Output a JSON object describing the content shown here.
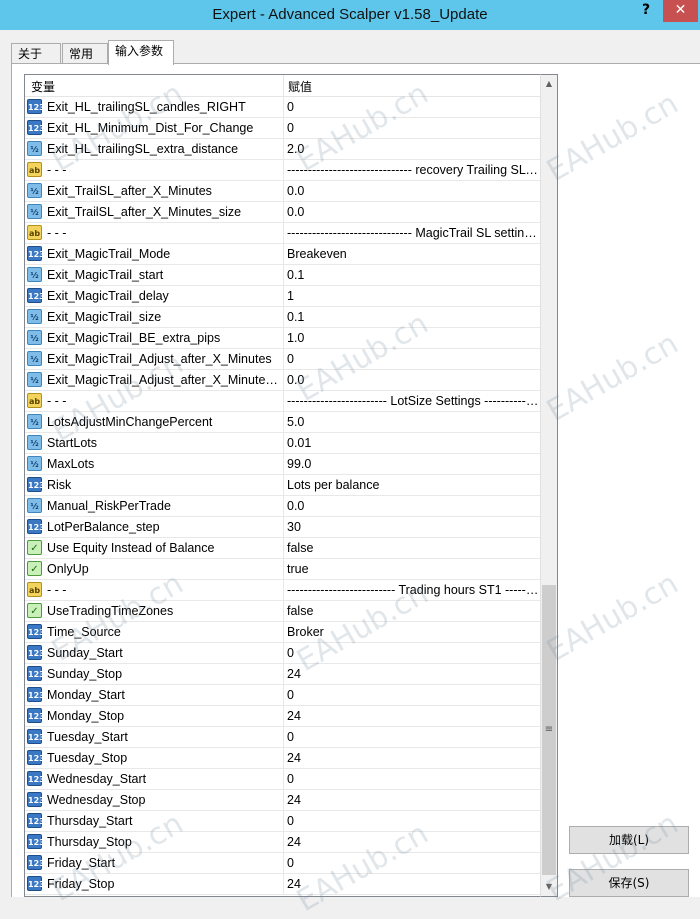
{
  "window": {
    "title": "Expert - Advanced Scalper v1.58_Update",
    "help_label": "?",
    "close_label": "✕"
  },
  "tabs": [
    {
      "label": "关于",
      "active": false
    },
    {
      "label": "常用",
      "active": false
    },
    {
      "label": "输入参数",
      "active": true
    }
  ],
  "grid": {
    "col_variable": "变量",
    "col_value": "赋值",
    "rows": [
      {
        "type": "int",
        "icon": "123",
        "name": "Exit_HL_trailingSL_candles_RIGHT",
        "value": "0"
      },
      {
        "type": "int",
        "icon": "123",
        "name": "Exit_HL_Minimum_Dist_For_Change",
        "value": "0"
      },
      {
        "type": "double",
        "icon": "½",
        "name": "Exit_HL_trailingSL_extra_distance",
        "value": "2.0"
      },
      {
        "type": "string",
        "icon": "ab",
        "name": "- - -",
        "value": "------------------------------ recovery Trailing SL ------------------------------"
      },
      {
        "type": "double",
        "icon": "½",
        "name": "Exit_TrailSL_after_X_Minutes",
        "value": "0.0"
      },
      {
        "type": "double",
        "icon": "½",
        "name": "Exit_TrailSL_after_X_Minutes_size",
        "value": "0.0"
      },
      {
        "type": "string",
        "icon": "ab",
        "name": "- - -",
        "value": "------------------------------ MagicTrail SL settings ------------------------------"
      },
      {
        "type": "int",
        "icon": "123",
        "name": "Exit_MagicTrail_Mode",
        "value": "Breakeven"
      },
      {
        "type": "double",
        "icon": "½",
        "name": "Exit_MagicTrail_start",
        "value": "0.1"
      },
      {
        "type": "int",
        "icon": "123",
        "name": "Exit_MagicTrail_delay",
        "value": "1"
      },
      {
        "type": "double",
        "icon": "½",
        "name": "Exit_MagicTrail_size",
        "value": "0.1"
      },
      {
        "type": "double",
        "icon": "½",
        "name": "Exit_MagicTrail_BE_extra_pips",
        "value": "1.0"
      },
      {
        "type": "double",
        "icon": "½",
        "name": "Exit_MagicTrail_Adjust_after_X_Minutes",
        "value": "0"
      },
      {
        "type": "double",
        "icon": "½",
        "name": "Exit_MagicTrail_Adjust_after_X_Minutes_size",
        "value": "0.0"
      },
      {
        "type": "string",
        "icon": "ab",
        "name": "- - -",
        "value": "------------------------ LotSize Settings ------------------------"
      },
      {
        "type": "double",
        "icon": "½",
        "name": "LotsAdjustMinChangePercent",
        "value": "5.0"
      },
      {
        "type": "double",
        "icon": "½",
        "name": "StartLots",
        "value": "0.01"
      },
      {
        "type": "double",
        "icon": "½",
        "name": "MaxLots",
        "value": "99.0"
      },
      {
        "type": "int",
        "icon": "123",
        "name": "Risk",
        "value": "Lots per balance"
      },
      {
        "type": "double",
        "icon": "½",
        "name": "Manual_RiskPerTrade",
        "value": "0.0"
      },
      {
        "type": "int",
        "icon": "123",
        "name": "LotPerBalance_step",
        "value": "30"
      },
      {
        "type": "bool",
        "icon": "✓",
        "name": "Use Equity Instead of Balance",
        "value": "false"
      },
      {
        "type": "bool",
        "icon": "✓",
        "name": "OnlyUp",
        "value": "true"
      },
      {
        "type": "string",
        "icon": "ab",
        "name": "- - -",
        "value": "-------------------------- Trading hours ST1 --------------------------"
      },
      {
        "type": "bool",
        "icon": "✓",
        "name": "UseTradingTimeZones",
        "value": "false"
      },
      {
        "type": "int",
        "icon": "123",
        "name": "Time_Source",
        "value": "Broker"
      },
      {
        "type": "int",
        "icon": "123",
        "name": "Sunday_Start",
        "value": "0"
      },
      {
        "type": "int",
        "icon": "123",
        "name": "Sunday_Stop",
        "value": "24"
      },
      {
        "type": "int",
        "icon": "123",
        "name": "Monday_Start",
        "value": "0"
      },
      {
        "type": "int",
        "icon": "123",
        "name": "Monday_Stop",
        "value": "24"
      },
      {
        "type": "int",
        "icon": "123",
        "name": "Tuesday_Start",
        "value": "0"
      },
      {
        "type": "int",
        "icon": "123",
        "name": "Tuesday_Stop",
        "value": "24"
      },
      {
        "type": "int",
        "icon": "123",
        "name": "Wednesday_Start",
        "value": "0"
      },
      {
        "type": "int",
        "icon": "123",
        "name": "Wednesday_Stop",
        "value": "24"
      },
      {
        "type": "int",
        "icon": "123",
        "name": "Thursday_Start",
        "value": "0"
      },
      {
        "type": "int",
        "icon": "123",
        "name": "Thursday_Stop",
        "value": "24"
      },
      {
        "type": "int",
        "icon": "123",
        "name": "Friday_Start",
        "value": "0"
      },
      {
        "type": "int",
        "icon": "123",
        "name": "Friday_Stop",
        "value": "24"
      }
    ]
  },
  "buttons": {
    "load_label": "加载(L)",
    "save_label": "保存(S)"
  },
  "scrollbar": {
    "up_glyph": "▲",
    "down_glyph": "▼",
    "grip_glyph": "≡"
  },
  "watermark": {
    "text": "EAHub.cn"
  }
}
